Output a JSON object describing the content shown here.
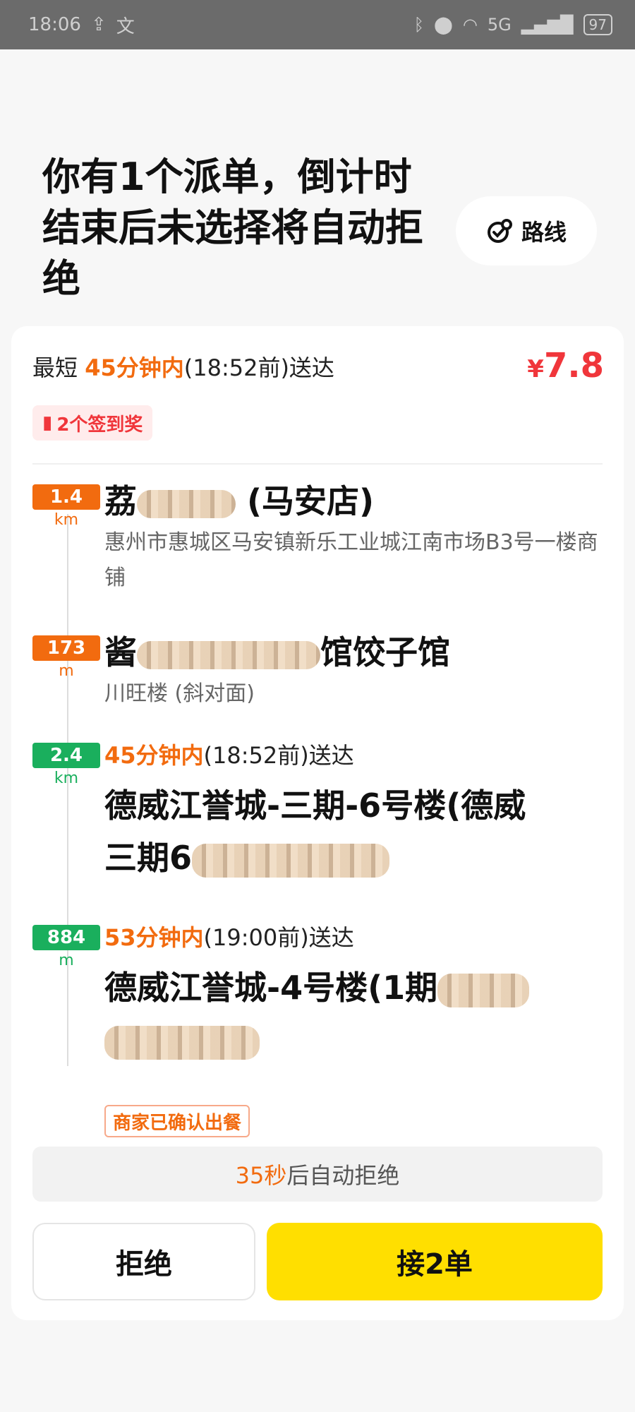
{
  "status_bar": {
    "time": "18:06",
    "network": "5G",
    "battery": "97"
  },
  "header": {
    "headline": "你有1个派单，倒计时结束后未选择将自动拒绝",
    "route_label": "路线"
  },
  "order": {
    "deliver_prefix": "最短",
    "deliver_duration": "45分钟内",
    "deliver_suffix": "(18:52前)送达",
    "price_symbol": "¥",
    "price": "7.8",
    "bonus_label": "2个签到奖"
  },
  "stops": [
    {
      "distance": "1.4",
      "unit": "km",
      "name": "荔",
      "name_tail": "(马安店)",
      "address": "惠州市惠城区马安镇新乐工业城江南市场B3号一楼商铺"
    },
    {
      "distance": "173",
      "unit": "m",
      "name": "酱",
      "name_tail": "馆饺子馆",
      "address": "川旺楼 (斜对面)"
    },
    {
      "distance": "2.4",
      "unit": "km",
      "duration": "45分钟内",
      "time_suffix": "(18:52前)送达",
      "dest_line1": "德威江誉城-三期-6号楼(德威",
      "dest_line2": "三期6"
    },
    {
      "distance": "884",
      "unit": "m",
      "duration": "53分钟内",
      "time_suffix": "(19:00前)送达",
      "dest_line1": "德威江誉城-4号楼(1期"
    }
  ],
  "merchant_tag": "商家已确认出餐",
  "countdown": {
    "seconds": "35秒",
    "suffix": "后自动拒绝"
  },
  "buttons": {
    "reject": "拒绝",
    "accept": "接2单"
  },
  "colors": {
    "accent_orange": "#F26B0F",
    "price_red": "#F0363B",
    "accept_yellow": "#FFDF00",
    "distance_green": "#1AAF5D"
  }
}
